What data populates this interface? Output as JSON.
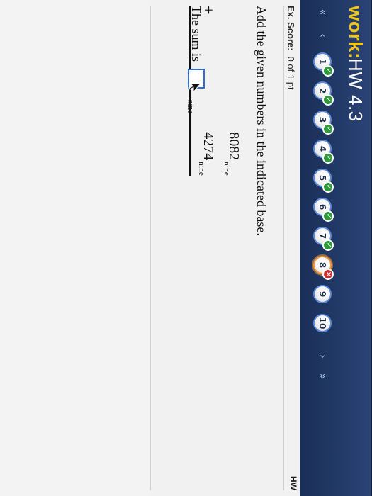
{
  "header": {
    "brand": "work:",
    "title": "HW 4.3"
  },
  "nav": {
    "left_arrows": [
      "«",
      "‹"
    ],
    "right_arrows": [
      "›",
      "»"
    ],
    "questions": [
      {
        "label": "1",
        "status": "correct",
        "badge": "✓"
      },
      {
        "label": "2",
        "status": "correct",
        "badge": "✓"
      },
      {
        "label": "3",
        "status": "correct",
        "badge": "✓"
      },
      {
        "label": "4",
        "status": "correct",
        "badge": "✓"
      },
      {
        "label": "5",
        "status": "correct",
        "badge": "✓"
      },
      {
        "label": "6",
        "status": "correct",
        "badge": "✓"
      },
      {
        "label": "7",
        "status": "correct",
        "badge": "✓"
      },
      {
        "label": "8",
        "status": "wrong",
        "badge": "×"
      },
      {
        "label": "9",
        "status": "unanswered",
        "badge": ""
      },
      {
        "label": "10",
        "status": "unanswered",
        "badge": ""
      }
    ]
  },
  "score": {
    "label": "Ex. Score:",
    "value": "0 of 1 pt"
  },
  "right_tag": "HW",
  "question": {
    "prompt": "Add the given numbers in the indicated base.",
    "num1": "8082",
    "num2": "4274",
    "base_subscript": "nine",
    "plus": "+",
    "sum_label": "The sum is",
    "answer_value": "",
    "answer_placeholder": ""
  },
  "colors": {
    "header_bg": "#213865",
    "brand_yellow": "#f2c51b",
    "check_green": "#2f9a3a",
    "wrong_red": "#cf2b2b",
    "current_orange": "#f29b3a",
    "input_blue": "#2f6edb"
  }
}
